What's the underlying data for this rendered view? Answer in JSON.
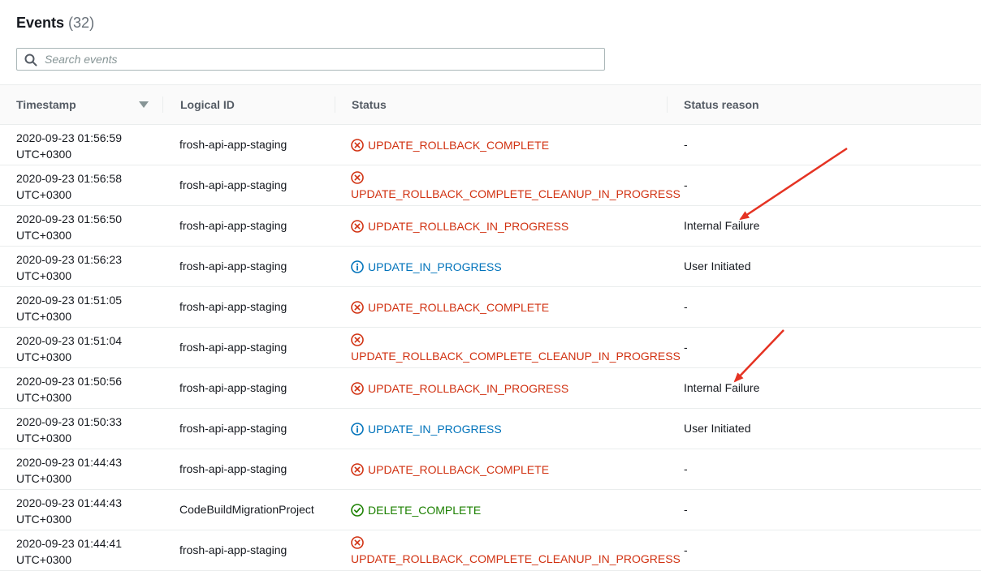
{
  "header": {
    "title": "Events",
    "count": "(32)"
  },
  "search": {
    "placeholder": "Search events",
    "value": ""
  },
  "columns": {
    "timestamp": "Timestamp",
    "logical_id": "Logical ID",
    "status": "Status",
    "status_reason": "Status reason"
  },
  "status_colors": {
    "failed": "#d13212",
    "in_progress": "#0073bb",
    "complete": "#1d8102"
  },
  "rows": [
    {
      "ts1": "2020-09-23 01:56:59",
      "ts2": "UTC+0300",
      "logical_id": "frosh-api-app-staging",
      "status": "UPDATE_ROLLBACK_COMPLETE",
      "status_kind": "failed",
      "icon": "x-circle-icon",
      "reason": "-"
    },
    {
      "ts1": "2020-09-23 01:56:58",
      "ts2": "UTC+0300",
      "logical_id": "frosh-api-app-staging",
      "status": "UPDATE_ROLLBACK_COMPLETE_CLEANUP_IN_PROGRESS",
      "status_kind": "failed",
      "icon": "x-circle-icon",
      "reason": "-"
    },
    {
      "ts1": "2020-09-23 01:56:50",
      "ts2": "UTC+0300",
      "logical_id": "frosh-api-app-staging",
      "status": "UPDATE_ROLLBACK_IN_PROGRESS",
      "status_kind": "failed",
      "icon": "x-circle-icon",
      "reason": "Internal Failure"
    },
    {
      "ts1": "2020-09-23 01:56:23",
      "ts2": "UTC+0300",
      "logical_id": "frosh-api-app-staging",
      "status": "UPDATE_IN_PROGRESS",
      "status_kind": "in_progress",
      "icon": "info-circle-icon",
      "reason": "User Initiated"
    },
    {
      "ts1": "2020-09-23 01:51:05",
      "ts2": "UTC+0300",
      "logical_id": "frosh-api-app-staging",
      "status": "UPDATE_ROLLBACK_COMPLETE",
      "status_kind": "failed",
      "icon": "x-circle-icon",
      "reason": "-"
    },
    {
      "ts1": "2020-09-23 01:51:04",
      "ts2": "UTC+0300",
      "logical_id": "frosh-api-app-staging",
      "status": "UPDATE_ROLLBACK_COMPLETE_CLEANUP_IN_PROGRESS",
      "status_kind": "failed",
      "icon": "x-circle-icon",
      "reason": "-"
    },
    {
      "ts1": "2020-09-23 01:50:56",
      "ts2": "UTC+0300",
      "logical_id": "frosh-api-app-staging",
      "status": "UPDATE_ROLLBACK_IN_PROGRESS",
      "status_kind": "failed",
      "icon": "x-circle-icon",
      "reason": "Internal Failure"
    },
    {
      "ts1": "2020-09-23 01:50:33",
      "ts2": "UTC+0300",
      "logical_id": "frosh-api-app-staging",
      "status": "UPDATE_IN_PROGRESS",
      "status_kind": "in_progress",
      "icon": "info-circle-icon",
      "reason": "User Initiated"
    },
    {
      "ts1": "2020-09-23 01:44:43",
      "ts2": "UTC+0300",
      "logical_id": "frosh-api-app-staging",
      "status": "UPDATE_ROLLBACK_COMPLETE",
      "status_kind": "failed",
      "icon": "x-circle-icon",
      "reason": "-"
    },
    {
      "ts1": "2020-09-23 01:44:43",
      "ts2": "UTC+0300",
      "logical_id": "CodeBuildMigrationProject",
      "status": "DELETE_COMPLETE",
      "status_kind": "complete",
      "icon": "check-circle-icon",
      "reason": "-"
    },
    {
      "ts1": "2020-09-23 01:44:41",
      "ts2": "UTC+0300",
      "logical_id": "frosh-api-app-staging",
      "status": "UPDATE_ROLLBACK_COMPLETE_CLEANUP_IN_PROGRESS",
      "status_kind": "failed",
      "icon": "x-circle-icon",
      "reason": "-"
    }
  ],
  "annotations": {
    "arrow_color": "#e53323"
  }
}
